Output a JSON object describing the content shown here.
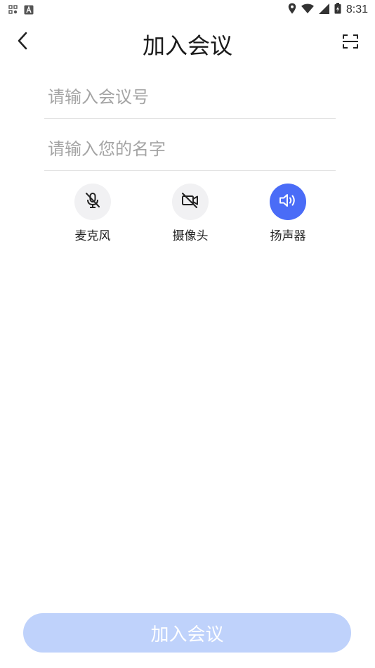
{
  "status_bar": {
    "time": "8:31",
    "left_icons": [
      "app-grid-icon",
      "a-badge-icon"
    ],
    "right_icons": [
      "location-icon",
      "wifi-icon",
      "signal-icon",
      "battery-icon"
    ]
  },
  "header": {
    "title": "加入会议",
    "back_icon": "chevron-left-icon",
    "scan_icon": "scan-icon"
  },
  "form": {
    "meeting_id": {
      "placeholder": "请输入会议号",
      "value": ""
    },
    "name": {
      "placeholder": "请输入您的名字",
      "value": ""
    }
  },
  "toggles": {
    "microphone": {
      "label": "麦克风",
      "icon": "mic-off-icon",
      "enabled": false
    },
    "camera": {
      "label": "摄像头",
      "icon": "camera-off-icon",
      "enabled": false
    },
    "speaker": {
      "label": "扬声器",
      "icon": "speaker-icon",
      "enabled": true
    }
  },
  "join_button": {
    "label": "加入会议",
    "enabled": false
  },
  "colors": {
    "accent": "#4a6cf7",
    "button_disabled": "#bfd2fb",
    "toggle_off_bg": "#f1f1f3",
    "placeholder": "#a4a4a4",
    "divider": "#e3e3e3"
  }
}
